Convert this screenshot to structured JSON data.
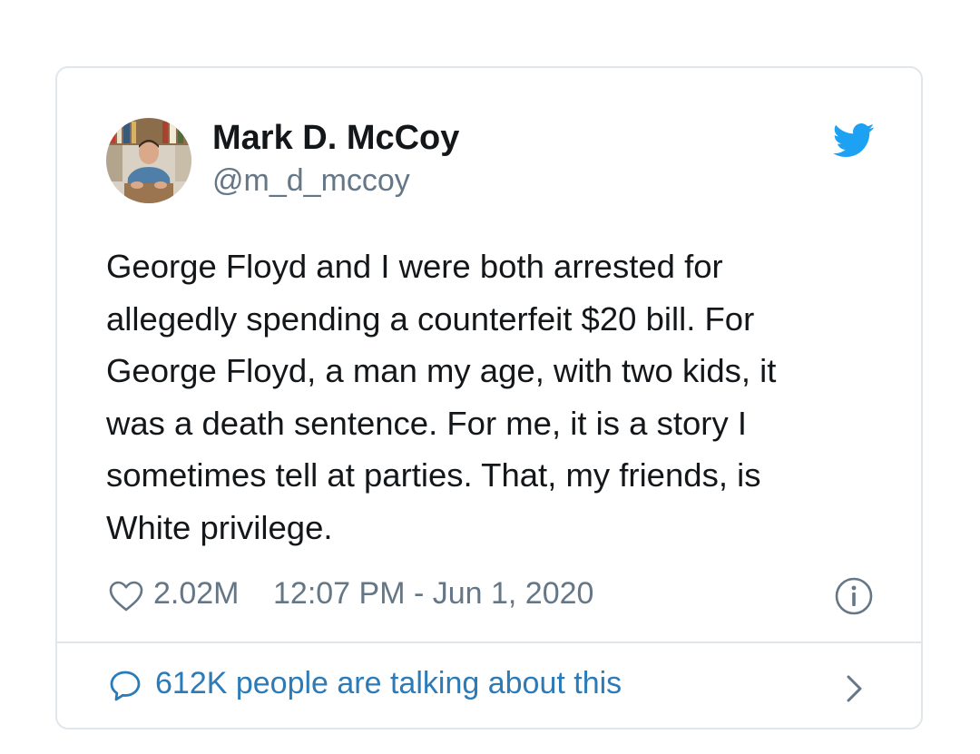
{
  "tweet": {
    "author": {
      "name": "Mark D. McCoy",
      "handle": "@m_d_mccoy",
      "avatar": "author-photo-icon"
    },
    "platform_icon": "twitter-bird-icon",
    "text_lines": [
      "George Floyd and I were both arrested for",
      "allegedly spending a counterfeit $20 bill. For",
      "George Floyd, a man my age, with two kids, it",
      "was a death sentence. For me, it is a story I",
      "sometimes tell at parties. That, my friends, is",
      "White privilege."
    ],
    "likes": "2.02M",
    "timestamp": "12:07 PM - Jun 1, 2020",
    "footer": {
      "conversation_text": "612K people are talking about this"
    }
  },
  "icons": {
    "like": "heart-outline-icon",
    "info": "info-circle-icon",
    "reply": "speech-bubble-icon",
    "chevron": "chevron-right-icon"
  },
  "colors": {
    "twitter_blue": "#1da1f2",
    "link_blue": "#2b7bb9",
    "text_primary": "#14171a",
    "text_secondary": "#657786",
    "border": "#e1e6ea"
  }
}
